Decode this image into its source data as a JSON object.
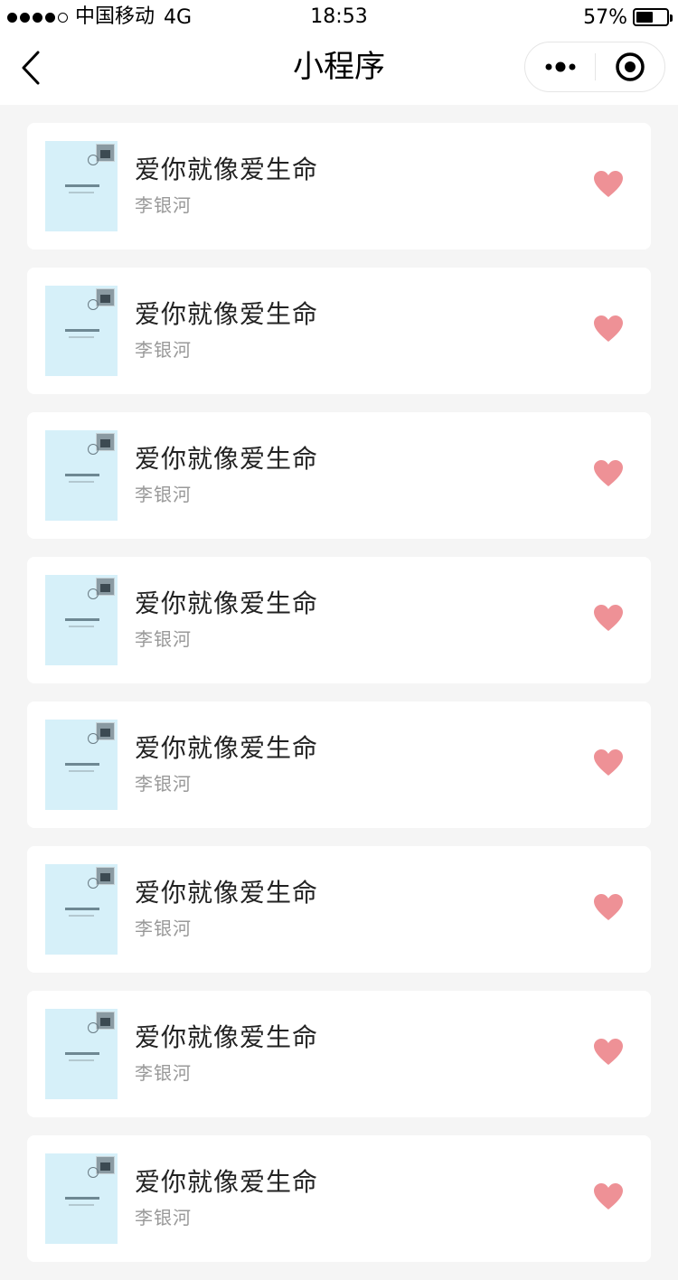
{
  "status_bar": {
    "carrier": "中国移动",
    "network": "4G",
    "time": "18:53",
    "battery_percent": "57%",
    "battery_level": 0.57,
    "signal_bars_filled": 4,
    "signal_bars_total": 5
  },
  "navbar": {
    "title": "小程序",
    "back_icon": "chevron-left-icon",
    "more_icon": "more-dots-icon",
    "close_icon": "target-close-icon"
  },
  "colors": {
    "heart": "#ee9196",
    "cover_bg": "#d6f0f9",
    "page_bg": "#f5f5f5"
  },
  "items": [
    {
      "title": "爱你就像爱生命",
      "author": "李银河"
    },
    {
      "title": "爱你就像爱生命",
      "author": "李银河"
    },
    {
      "title": "爱你就像爱生命",
      "author": "李银河"
    },
    {
      "title": "爱你就像爱生命",
      "author": "李银河"
    },
    {
      "title": "爱你就像爱生命",
      "author": "李银河"
    },
    {
      "title": "爱你就像爱生命",
      "author": "李银河"
    },
    {
      "title": "爱你就像爱生命",
      "author": "李银河"
    },
    {
      "title": "爱你就像爱生命",
      "author": "李银河"
    }
  ]
}
